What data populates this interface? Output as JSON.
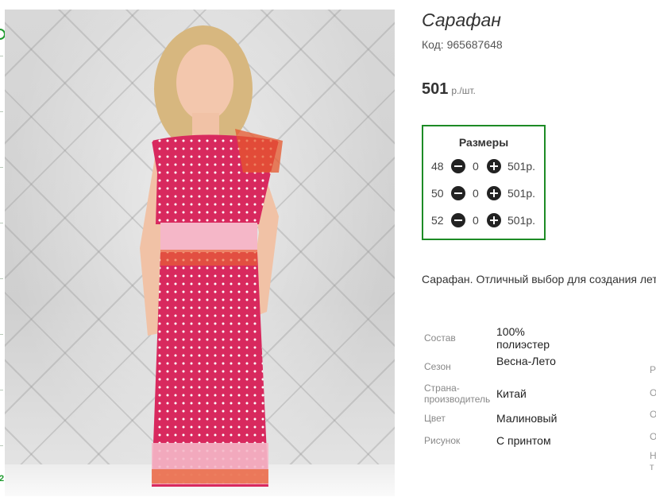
{
  "product": {
    "title": "Сарафан",
    "code": "Код: 965687648",
    "price": "501",
    "price_unit": "р./шт.",
    "description": "Сарафан. Отличный выбор для создания лет"
  },
  "sizes": {
    "title": "Размеры",
    "rows": [
      {
        "size": "48",
        "qty": "0",
        "price": "501р."
      },
      {
        "size": "50",
        "qty": "0",
        "price": "501р."
      },
      {
        "size": "52",
        "qty": "0",
        "price": "501р."
      }
    ]
  },
  "specs": [
    {
      "label": "Состав",
      "value": "100% полиэстер"
    },
    {
      "label": "Сезон",
      "value": "Весна-Лето"
    },
    {
      "label": "Страна-производитель",
      "value": "Китай"
    },
    {
      "label": "Цвет",
      "value": "Малиновый"
    },
    {
      "label": "Рисунок",
      "value": "С принтом"
    }
  ],
  "right_fragments": [
    "Р",
    "О",
    "О",
    "О",
    "Н",
    "т"
  ],
  "left_fragment": "2",
  "colors": {
    "accent_green": "#1d8b25",
    "dress_pink": "#d8295e"
  }
}
